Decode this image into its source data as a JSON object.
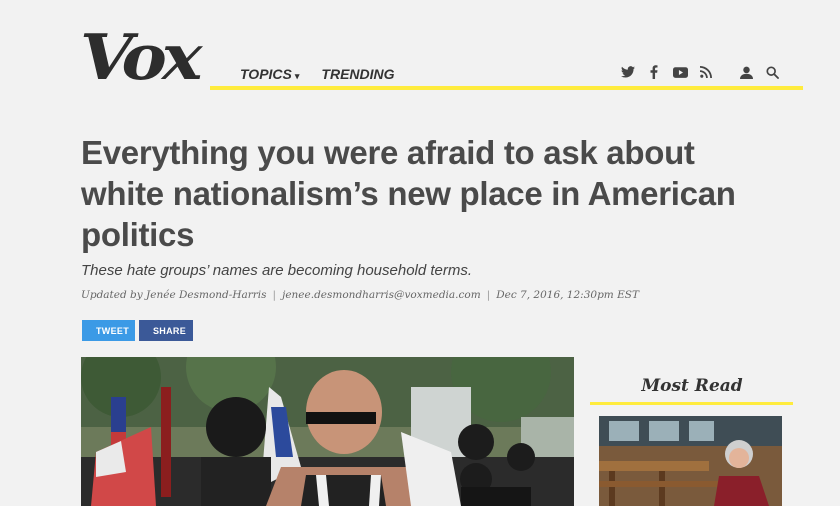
{
  "brand": {
    "logo_text": "Vox"
  },
  "nav": {
    "topics": "TOPICS",
    "trending": "TRENDING"
  },
  "header_icons": [
    "twitter-icon",
    "facebook-icon",
    "youtube-icon",
    "rss-icon",
    "user-icon",
    "search-icon"
  ],
  "article": {
    "headline": "Everything you were afraid to ask about white nationalism’s new place in American politics",
    "dek": "These hate groups’ names are becoming household terms.",
    "byline": {
      "updated_by": "Updated by",
      "author": "Jenée Desmond-Harris",
      "email": "jenee.desmondharris@voxmedia.com",
      "date": "Dec 7, 2016, 12:30pm EST"
    },
    "share": {
      "tweet": "TWEET",
      "facebook": "SHARE"
    }
  },
  "sidebar": {
    "most_read_title": "Most Read"
  },
  "colors": {
    "accent_yellow": "#ffec3d",
    "twitter_blue": "#3b9ae6",
    "facebook_blue": "#3b5998"
  }
}
